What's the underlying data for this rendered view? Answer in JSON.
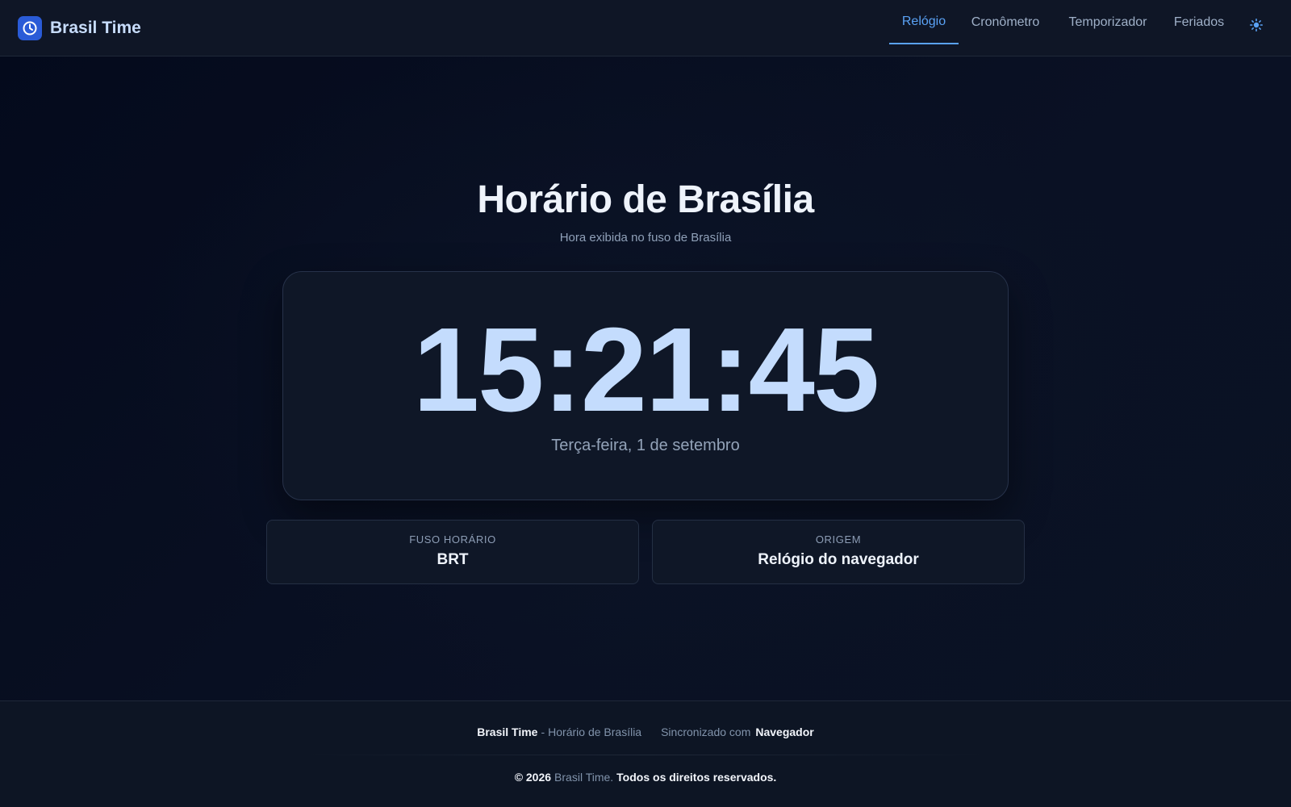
{
  "header": {
    "brand": "Brasil Time",
    "nav": [
      {
        "label": "Relógio",
        "active": true
      },
      {
        "label": "Cronômetro",
        "active": false
      },
      {
        "label": "Temporizador",
        "active": false
      },
      {
        "label": "Feriados",
        "active": false
      }
    ],
    "theme_icon": "sun-icon"
  },
  "main": {
    "title": "Horário de Brasília",
    "subtitle": "Hora exibida no fuso de Brasília",
    "clock": {
      "time": "15:21:45",
      "date": "Terça-feira, 1 de setembro"
    },
    "info_cards": [
      {
        "label": "FUSO HORÁRIO",
        "value": "BRT"
      },
      {
        "label": "ORIGEM",
        "value": "Relógio do navegador"
      }
    ]
  },
  "footer": {
    "brand": "Brasil Time",
    "dash": "-",
    "tagline": "Horário de Brasília",
    "sync_label": "Sincronizado com",
    "sync_value": "Navegador",
    "copyright_prefix": "© 2026",
    "copyright_brand": "Brasil Time.",
    "copyright_suffix": "Todos os direitos reservados."
  },
  "colors": {
    "accent": "#5aa2f5",
    "background": "#070d1e",
    "card": "#0f1727",
    "clock_digits": "#c4dcfd",
    "logo_bg": "#2a5bd7"
  }
}
